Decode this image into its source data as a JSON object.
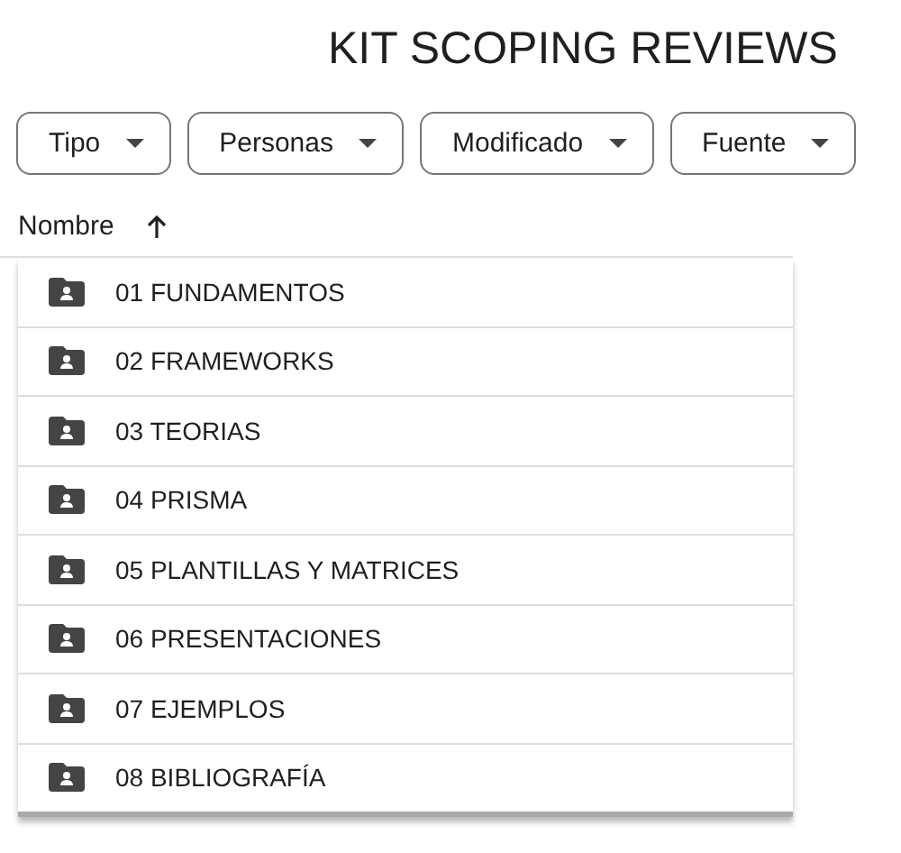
{
  "title": "KIT SCOPING REVIEWS",
  "filters": [
    {
      "label": "Tipo"
    },
    {
      "label": "Personas"
    },
    {
      "label": "Modificado"
    },
    {
      "label": "Fuente"
    }
  ],
  "table": {
    "columns": [
      {
        "label": "Nombre",
        "sort_ascending": true
      }
    ],
    "rows": [
      {
        "name": "01 FUNDAMENTOS"
      },
      {
        "name": "02 FRAMEWORKS"
      },
      {
        "name": "03 TEORIAS"
      },
      {
        "name": "04 PRISMA"
      },
      {
        "name": "05 PLANTILLAS Y MATRICES"
      },
      {
        "name": "06 PRESENTACIONES"
      },
      {
        "name": "07 EJEMPLOS"
      },
      {
        "name": "08 BIBLIOGRAFÍA"
      }
    ]
  }
}
